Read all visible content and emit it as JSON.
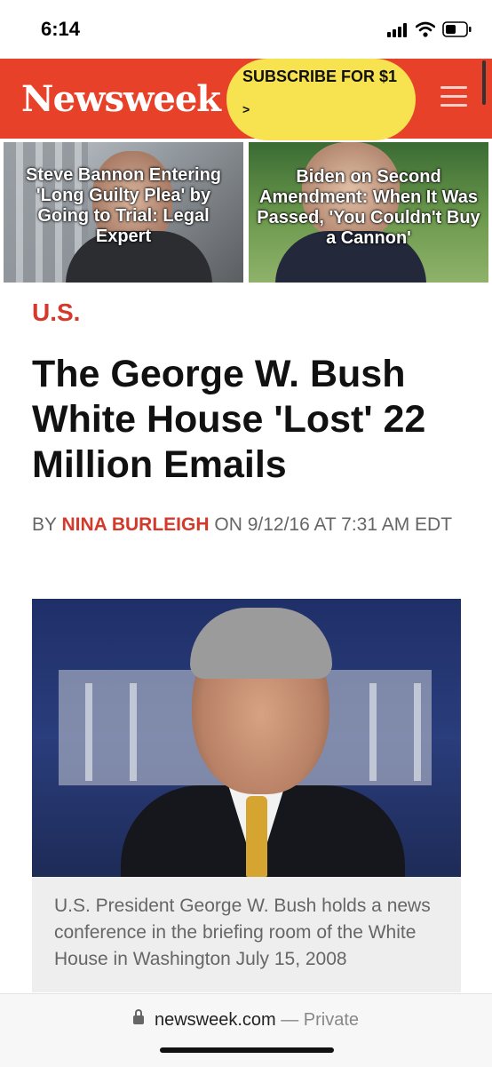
{
  "status_bar": {
    "time": "6:14",
    "icons": [
      "cellular-signal-icon",
      "wifi-icon",
      "battery-icon"
    ]
  },
  "header": {
    "logo": "Newsweek",
    "subscribe_label": "SUBSCRIBE FOR $1",
    "subscribe_arrow": ">",
    "menu_icon": "hamburger-menu-icon",
    "background_color": "#e8412a",
    "subscribe_color": "#f7e24f"
  },
  "promos": [
    {
      "title": "Steve Bannon Entering 'Long Guilty Plea' by Going to Trial: Legal Expert"
    },
    {
      "title": "Biden on Second Amendment: When It Was Passed, 'You Couldn't Buy a Cannon'"
    }
  ],
  "article": {
    "section": "U.S.",
    "headline": "The George W. Bush White House 'Lost' 22 Million Emails",
    "byline_prefix": "BY ",
    "author": "NINA BURLEIGH",
    "byline_suffix": " ON 9/12/16 AT 7:31 AM EDT",
    "image_caption": "U.S. President George W. Bush holds a news conference in the briefing room of the White House in Washington July 15, 2008",
    "accent_color": "#d33a2c"
  },
  "browser": {
    "domain": "newsweek.com",
    "mode": " — Private"
  }
}
